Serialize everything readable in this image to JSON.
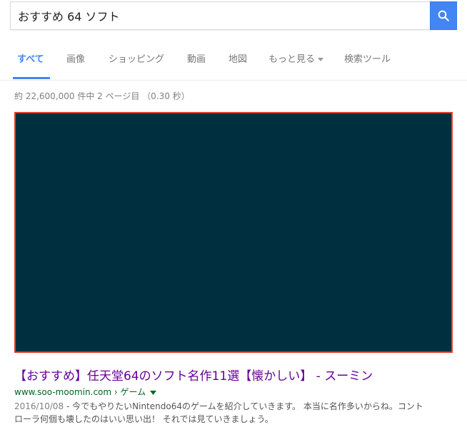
{
  "search": {
    "query": "おすすめ 64 ソフト",
    "button_icon": "search-icon",
    "button_color": "#4285f4"
  },
  "tabs": [
    {
      "label": "すべて",
      "active": true
    },
    {
      "label": "画像"
    },
    {
      "label": "ショッピング"
    },
    {
      "label": "動画"
    },
    {
      "label": "地図"
    },
    {
      "label": "もっと見る",
      "has_dropdown": true
    },
    {
      "label": "検索ツール"
    }
  ],
  "stats": "約 22,600,000 件中 2 ページ目 （0.30 秒）",
  "media": {
    "background_color": "#003040",
    "border_color": "#e0402f"
  },
  "result": {
    "title": "【おすすめ】任天堂64のソフト名作11選【懐かしい】 - スーミン",
    "url": "www.soo-moomin.com › ゲーム",
    "date": "2016/10/08",
    "snippet_line1": " - 今でもやりたいNintendo64のゲームを紹介していきます。 本当に名作多いからね。コント",
    "snippet_line2": "ローラ何個も壊したのはいい思い出！ それでは見ていきましょう。",
    "title_color": "#660099",
    "url_color": "#006621"
  }
}
